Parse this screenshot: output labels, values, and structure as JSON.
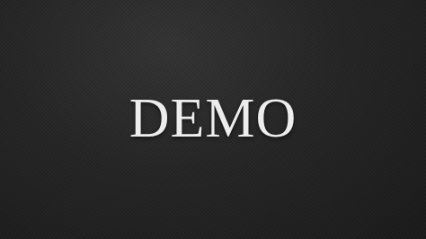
{
  "slide": {
    "title": "DEMO"
  },
  "colors": {
    "background": "#262626",
    "text": "#ededed"
  }
}
